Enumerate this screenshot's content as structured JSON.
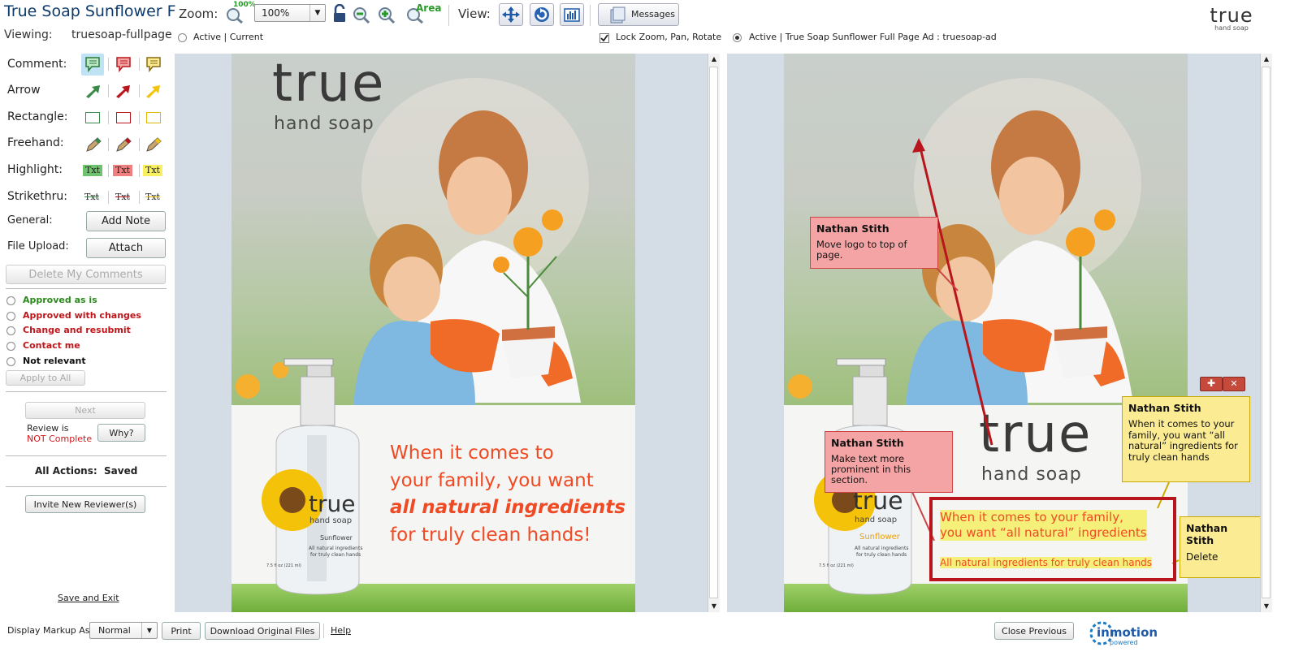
{
  "header": {
    "title": "True Soap Sunflower F",
    "zoom_label": "Zoom:",
    "zoom_value": "100%",
    "zoom_100_badge": "100%",
    "zoom_area_label": "Area",
    "view_label": "View:",
    "messages_label": "Messages",
    "brand_true": "true",
    "brand_hand_soap": "hand soap"
  },
  "viewing": {
    "label": "Viewing:",
    "filename": "truesoap-fullpage",
    "left_radio_label": "Active | Current",
    "lock_label": "Lock Zoom, Pan, Rotate",
    "right_radio_label": "Active | True Soap Sunflower Full Page Ad : truesoap-ad"
  },
  "tools": {
    "comment": "Comment:",
    "arrow": "Arrow",
    "rectangle": "Rectangle:",
    "freehand": "Freehand:",
    "highlight": "Highlight:",
    "strikethru": "Strikethru:",
    "txt": "Txt",
    "general": "General:",
    "add_note": "Add Note",
    "file_upload": "File Upload:",
    "attach": "Attach",
    "delete_my_comments": "Delete My Comments"
  },
  "approval": {
    "options": [
      {
        "label": "Approved as is",
        "color": "#2a8a1a"
      },
      {
        "label": "Approved with changes",
        "color": "#c0161b"
      },
      {
        "label": "Change and resubmit",
        "color": "#c0161b"
      },
      {
        "label": "Contact me",
        "color": "#c0161b"
      },
      {
        "label": "Not relevant",
        "color": "#111111"
      }
    ],
    "apply_all": "Apply to All",
    "next": "Next",
    "review_is": "Review is",
    "not_complete": "NOT Complete",
    "why": "Why?",
    "all_actions_label": "All Actions:",
    "all_actions_value": "Saved",
    "invite": "Invite New Reviewer(s)",
    "save_exit": "Save and Exit"
  },
  "footer": {
    "display_markup_label": "Display Markup As:",
    "markup_value": "Normal",
    "print": "Print",
    "download": "Download Original Files",
    "help": "Help",
    "close_previous": "Close Previous",
    "inmotion": "inmotion",
    "powered": "powered"
  },
  "ad": {
    "logo_true": "true",
    "logo_hand_soap": "hand soap",
    "headline_1": "When it comes to",
    "headline_2": "your family, you want",
    "headline_3": "all natural ingredients",
    "headline_4": "for truly clean hands!",
    "bottle_true": "true",
    "bottle_hand_soap": "hand soap",
    "bottle_sunflower": "Sunflower",
    "bottle_desc_1": "All natural ingredients",
    "bottle_desc_2": "for truly clean hands",
    "bottle_volume": "7.5 fl oz (221 ml)"
  },
  "ad_right": {
    "headline_1": "When it comes to your family,",
    "headline_2": "you want “all natural” ingredients",
    "subline": "All natural ingredients for truly clean hands"
  },
  "annotations": [
    {
      "author": "Nathan Stith",
      "text": "Move logo to top of page."
    },
    {
      "author": "Nathan Stith",
      "text": "Make text more prominent in this section."
    },
    {
      "author": "Nathan Stith",
      "text": "When it comes to your family, you want “all natural” ingredients for truly clean hands"
    },
    {
      "author": "Nathan Stith",
      "text": "Delete"
    }
  ],
  "colors": {
    "accent_orange": "#ef4a23",
    "note_red": "#f4a4a4",
    "note_yellow": "#fbeb93",
    "markup_red": "#b8161c"
  }
}
